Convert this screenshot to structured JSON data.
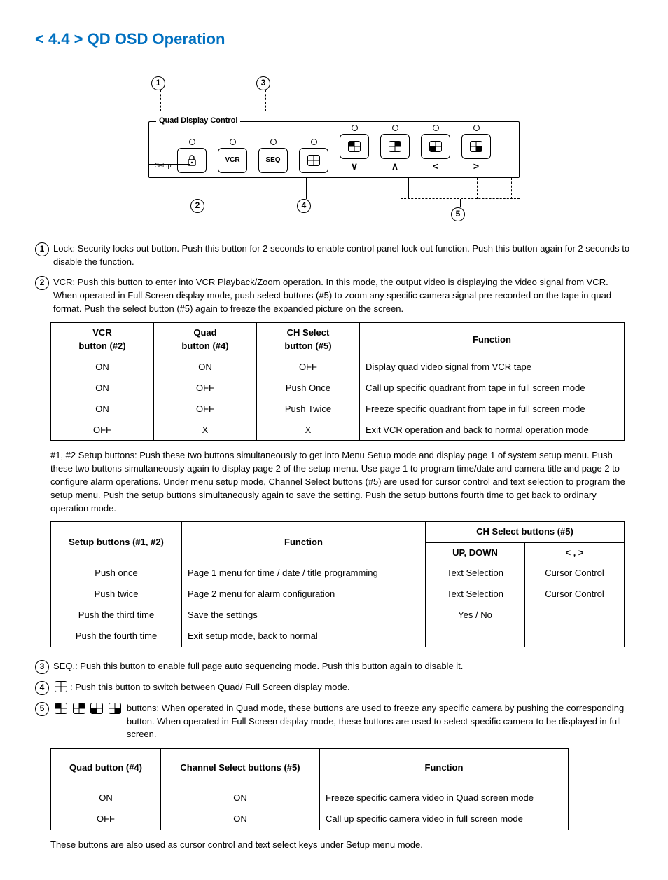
{
  "title": "< 4.4 >  QD  OSD Operation",
  "diagram": {
    "group_label": "Quad Display Control",
    "btn_vcr": "VCR",
    "btn_seq": "SEQ",
    "setup_label": "Setup",
    "sym_down": "∨",
    "sym_up": "∧",
    "sym_left": "<",
    "sym_right": ">"
  },
  "items": {
    "n1": "Lock: Security locks out button. Push this button for 2 seconds to enable control panel lock out function. Push this button again for 2 seconds to disable the function.",
    "n2": "VCR: Push this button to enter into VCR Playback/Zoom operation. In this mode, the output video is displaying the video signal from VCR. When operated in Full Screen display mode, push select buttons (#5) to zoom any specific camera signal pre-recorded on the tape in quad format. Push the select button (#5) again to freeze the expanded picture on the screen.",
    "n2b": "#1, #2 Setup buttons: Push these two buttons simultaneously to get into Menu Setup mode and display page 1 of system setup menu. Push these two buttons simultaneously again to display page 2 of the setup menu. Use page 1 to program time/date and camera title and page 2 to configure alarm operations. Under menu setup mode, Channel Select buttons (#5) are used for cursor control and text selection to program the setup menu. Push the setup buttons simultaneously again to save the setting. Push the setup buttons fourth time to get back to ordinary operation mode.",
    "n3": "SEQ.: Push this button to enable full page auto sequencing mode. Push this button again to disable it.",
    "n4": ": Push this button to switch between Quad/ Full Screen display mode.",
    "n5": "buttons:  When operated in Quad mode, these buttons are used to freeze any specific camera by pushing the corresponding button. When operated in Full Screen display mode, these buttons are used to select specific camera to be displayed in full screen.",
    "n5b": "These buttons are also used as cursor control and text select keys under Setup menu mode."
  },
  "table1": {
    "h1": "VCR\nbutton (#2)",
    "h2": "Quad\nbutton (#4)",
    "h3": "CH Select\nbutton (#5)",
    "h4": "Function",
    "rows": [
      [
        "ON",
        "ON",
        "OFF",
        "Display quad video signal from VCR tape"
      ],
      [
        "ON",
        "OFF",
        "Push Once",
        "Call up specific quadrant from tape in full screen mode"
      ],
      [
        "ON",
        "OFF",
        "Push Twice",
        "Freeze specific quadrant from tape in full screen mode"
      ],
      [
        "OFF",
        "X",
        "X",
        "Exit VCR operation and back to normal operation mode"
      ]
    ]
  },
  "table2": {
    "h1": "Setup buttons (#1, #2)",
    "h2": "Function",
    "h3": "CH Select buttons (#5)",
    "h3a": "UP, DOWN",
    "h3b": "<   ,   >",
    "rows": [
      [
        "Push once",
        "Page 1 menu for time / date / title programming",
        "Text Selection",
        "Cursor Control"
      ],
      [
        "Push twice",
        "Page 2 menu for alarm configuration",
        "Text Selection",
        "Cursor Control"
      ],
      [
        "Push the third time",
        "Save the settings",
        "Yes / No",
        ""
      ],
      [
        "Push the fourth time",
        "Exit setup mode, back to normal",
        "",
        ""
      ]
    ]
  },
  "table3": {
    "h1": "Quad button (#4)",
    "h2": "Channel Select buttons (#5)",
    "h3": "Function",
    "rows": [
      [
        "ON",
        "ON",
        "Freeze specific camera video in Quad screen mode"
      ],
      [
        "OFF",
        "ON",
        "Call up specific camera video in full screen mode"
      ]
    ]
  }
}
